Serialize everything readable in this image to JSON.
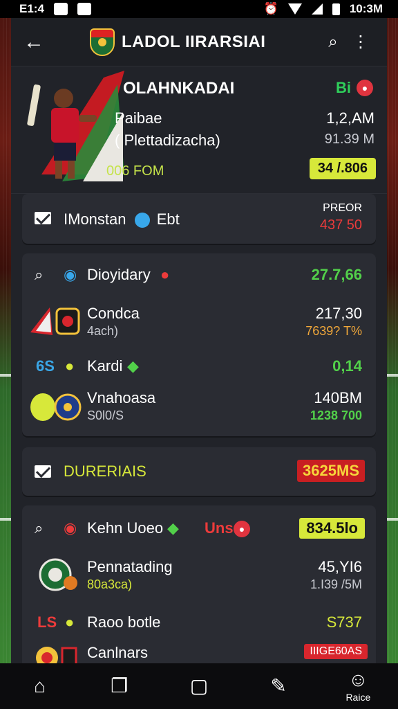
{
  "status_bar": {
    "time_left": "E1:4",
    "time_right": "10:3M"
  },
  "topbar": {
    "title": "LADOL IIRARSIAI",
    "back_icon": "arrow-left-icon",
    "search_icon": "search-icon",
    "menu_icon": "more-vertical-icon"
  },
  "hero": {
    "name": "OLAHNKADAI",
    "badge": "Bi",
    "line1": "Paibae",
    "line2": "( Plettadizacha)",
    "value1": "1,2,AM",
    "value2": "91.39 M",
    "footer": "006 FOM",
    "pill": "34 /.806"
  },
  "card_monstan": {
    "label": "IMonstan",
    "tag": "Ebt",
    "right_top": "PREOR",
    "right_bottom": "437 50"
  },
  "card_list": {
    "rows": [
      {
        "lead": "Q",
        "title": "Dioyidary",
        "value": "27.7,66"
      },
      {
        "title": "Condca",
        "sub": "4ach)",
        "value": "217,30",
        "sub_value": "7639? T%"
      },
      {
        "lead": "6S",
        "title": "Kardi",
        "value": "0,14"
      },
      {
        "title": "Vnahoasa",
        "sub": "S0l0/S",
        "value": "140BM",
        "sub_value": "1238 700"
      }
    ]
  },
  "card_duren": {
    "label": "DURERIAIS",
    "value": "3625MS"
  },
  "card_bottom": {
    "rows": [
      {
        "lead": "Q",
        "title": "Kehn Uoeo",
        "tag": "Uns",
        "value": "834.5lo"
      },
      {
        "title": "Pennatading",
        "sub": "80a3ca)",
        "value": "45,YI6",
        "sub_value": "1.I39 /5M"
      },
      {
        "lead": "LS",
        "title": "Raoo botle",
        "value": "S737"
      },
      {
        "title": "Canlnars",
        "value": "IIIGE60AS"
      }
    ]
  },
  "bottom_nav": [
    {
      "icon": "home-icon",
      "label": ""
    },
    {
      "icon": "cards-icon",
      "label": ""
    },
    {
      "icon": "square-icon",
      "label": ""
    },
    {
      "icon": "edit-icon",
      "label": ""
    },
    {
      "icon": "profile-icon",
      "label": "Raice"
    }
  ],
  "colors": {
    "app_bg": "#212329",
    "card_bg": "#2a2c33",
    "accent_green": "#52d04a",
    "accent_red": "#ec3b3b",
    "accent_yellow": "#d7e83a"
  }
}
